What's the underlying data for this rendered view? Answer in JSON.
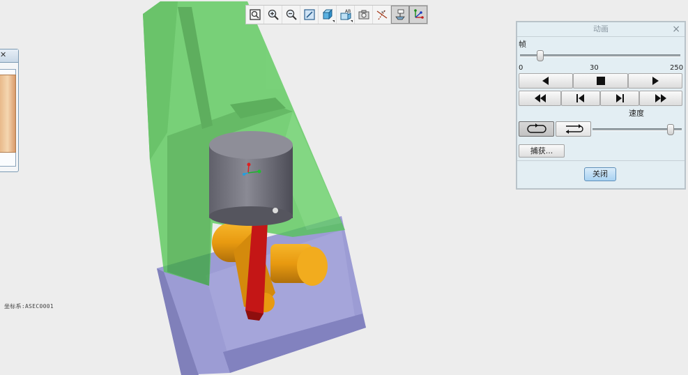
{
  "scene": {
    "csys_label": "坐标系:ASEC0001"
  },
  "left_panel": {
    "close_glyph": "✕"
  },
  "toolbar": {
    "buttons": [
      {
        "name": "zoom-fit-button",
        "icon": "zoom-fit-icon"
      },
      {
        "name": "zoom-in-button",
        "icon": "zoom-in-icon"
      },
      {
        "name": "zoom-out-button",
        "icon": "zoom-out-icon"
      },
      {
        "name": "repaint-button",
        "icon": "repaint-icon"
      },
      {
        "name": "display-style-button",
        "icon": "cube-shade-icon"
      },
      {
        "name": "saved-views-button",
        "icon": "saved-view-icon"
      },
      {
        "name": "view-manager-button",
        "icon": "camera-view-icon"
      },
      {
        "name": "datum-display-button",
        "icon": "datum-axis-icon"
      },
      {
        "name": "annotation-display-button",
        "icon": "annotation-icon",
        "active": true
      },
      {
        "name": "csys-display-button",
        "icon": "csys-icon",
        "active": true
      }
    ]
  },
  "dialog": {
    "title": "动画",
    "close_glyph": "×",
    "frame_label": "帧",
    "slider": {
      "min": "0",
      "current": "30",
      "max": "250",
      "value": 30
    },
    "speed_label": "速度",
    "speed_level": 0.87,
    "capture_label": "捕获...",
    "close_label": "关闭"
  },
  "colors": {
    "housing_green": "#4cc64c",
    "base_purple": "#8c8ccc",
    "piston_grey": "#7a7a84",
    "rod_red": "#c41616",
    "crank_orange": "#e89a10",
    "dialog_bg": "#e3eef3",
    "close_btn": "#a8d2f2"
  }
}
